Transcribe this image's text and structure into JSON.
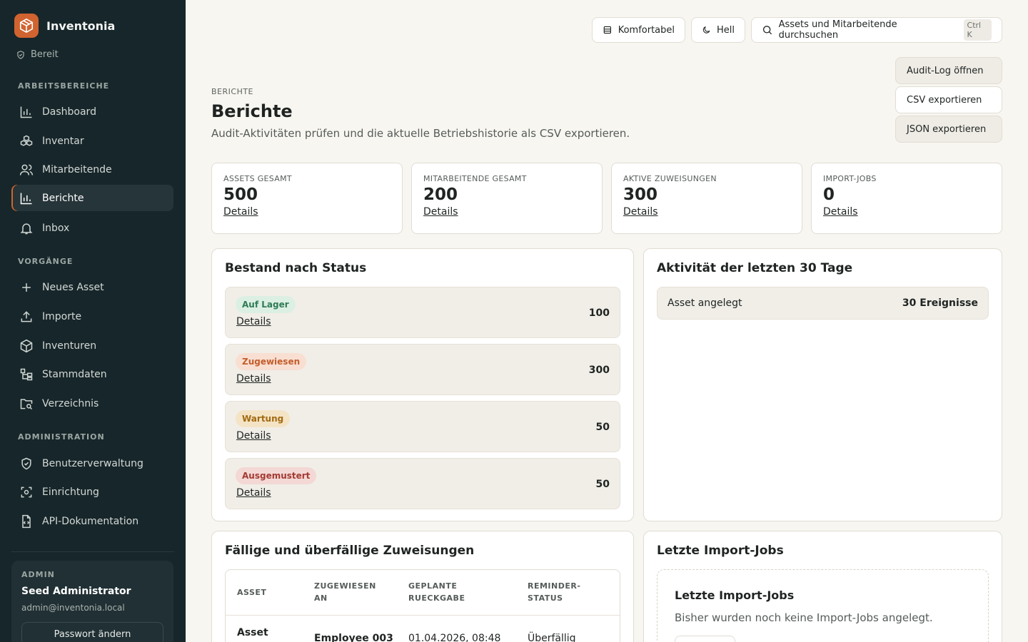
{
  "app": {
    "name": "Inventonia",
    "status": "Bereit"
  },
  "sidebar": {
    "sections": [
      {
        "label": "ARBEITSBEREICHE",
        "items": [
          {
            "label": "Dashboard",
            "icon": "bar-chart-icon"
          },
          {
            "label": "Inventar",
            "icon": "boxes-icon"
          },
          {
            "label": "Mitarbeitende",
            "icon": "users-icon"
          },
          {
            "label": "Berichte",
            "icon": "bar-chart-icon",
            "active": true
          },
          {
            "label": "Inbox",
            "icon": "bell-icon"
          }
        ]
      },
      {
        "label": "VORGÄNGE",
        "items": [
          {
            "label": "Neues Asset",
            "icon": "plus-icon"
          },
          {
            "label": "Importe",
            "icon": "upload-icon"
          },
          {
            "label": "Inventuren",
            "icon": "package-icon"
          },
          {
            "label": "Stammdaten",
            "icon": "tree-icon"
          },
          {
            "label": "Verzeichnis",
            "icon": "folder-search-icon"
          }
        ]
      },
      {
        "label": "ADMINISTRATION",
        "items": [
          {
            "label": "Benutzerverwaltung",
            "icon": "shield-icon"
          },
          {
            "label": "Einrichtung",
            "icon": "settings-scan-icon"
          },
          {
            "label": "API-Dokumentation",
            "icon": "file-code-icon"
          }
        ]
      }
    ],
    "user": {
      "role": "ADMIN",
      "name": "Seed Administrator",
      "email": "admin@inventonia.local",
      "password_button": "Passwort ändern"
    }
  },
  "topbar": {
    "density_label": "Komfortabel",
    "theme_label": "Hell",
    "search_label": "Assets und Mitarbeitende durchsuchen",
    "search_shortcut": "Ctrl K"
  },
  "header": {
    "eyebrow": "BERICHTE",
    "title": "Berichte",
    "subtitle": "Audit-Aktivitäten prüfen und die aktuelle Betriebshistorie als CSV exportieren.",
    "actions": [
      "Audit-Log öffnen",
      "CSV exportieren",
      "JSON exportieren"
    ]
  },
  "kpis": [
    {
      "label": "ASSETS GESAMT",
      "value": "500",
      "link": "Details"
    },
    {
      "label": "MITARBEITENDE GESAMT",
      "value": "200",
      "link": "Details"
    },
    {
      "label": "AKTIVE ZUWEISUNGEN",
      "value": "300",
      "link": "Details"
    },
    {
      "label": "IMPORT-JOBS",
      "value": "0",
      "link": "Details"
    }
  ],
  "status_panel": {
    "title": "Bestand nach Status",
    "rows": [
      {
        "label": "Auf Lager",
        "count": "100",
        "link": "Details",
        "color": "#2f7b55",
        "bg": "#dcefe3"
      },
      {
        "label": "Zugewiesen",
        "count": "300",
        "link": "Details",
        "color": "#c45d2b",
        "bg": "#f8dfd2"
      },
      {
        "label": "Wartung",
        "count": "50",
        "link": "Details",
        "color": "#a26a12",
        "bg": "#f4e4c5"
      },
      {
        "label": "Ausgemustert",
        "count": "50",
        "link": "Details",
        "color": "#a33a33",
        "bg": "#f3d8d5"
      }
    ]
  },
  "activity_panel": {
    "title": "Aktivität der letzten 30 Tage",
    "rows": [
      {
        "label": "Asset angelegt",
        "value": "30 Ereignisse"
      }
    ]
  },
  "due_panel": {
    "title": "Fällige und überfällige Zuweisungen",
    "columns": [
      "ASSET",
      "ZUGEWIESEN AN",
      "GEPLANTE RUECKGABE",
      "REMINDER-STATUS"
    ],
    "rows": [
      {
        "asset": "Asset",
        "assignee": "Employee 003",
        "return": "01.04.2026, 08:48",
        "status": "Überfällig"
      }
    ]
  },
  "imports_panel": {
    "title": "Letzte Import-Jobs",
    "empty_title": "Letzte Import-Jobs",
    "empty_text": "Bisher wurden noch keine Import-Jobs angelegt."
  },
  "colors": {
    "sidebar_bg": "#17262a",
    "accent": "#d0632f",
    "page_bg": "#f8f6f1"
  }
}
